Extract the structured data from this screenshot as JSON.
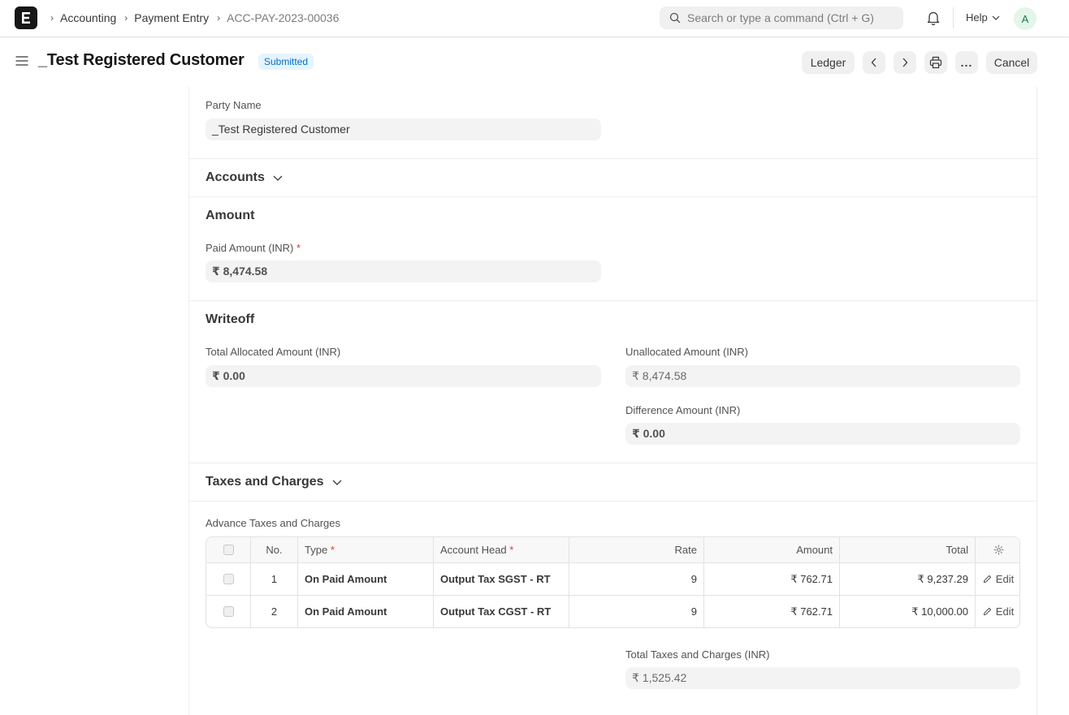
{
  "navbar": {
    "breadcrumbs": [
      "Accounting",
      "Payment Entry",
      "ACC-PAY-2023-00036"
    ],
    "search_placeholder": "Search or type a command (Ctrl + G)",
    "help_label": "Help",
    "avatar_initial": "A"
  },
  "page": {
    "title": "_Test Registered Customer",
    "status": "Submitted",
    "buttons": {
      "ledger": "Ledger",
      "cancel": "Cancel",
      "more": "..."
    }
  },
  "form": {
    "party_name": {
      "label": "Party Name",
      "value": "_Test Registered Customer"
    },
    "accounts_section": "Accounts",
    "amount_section": "Amount",
    "paid_amount": {
      "label": "Paid Amount (INR)",
      "value": "₹ 8,474.58"
    },
    "writeoff_section": "Writeoff",
    "total_allocated": {
      "label": "Total Allocated Amount (INR)",
      "value": "₹ 0.00"
    },
    "unallocated": {
      "label": "Unallocated Amount (INR)",
      "value": "₹ 8,474.58"
    },
    "difference": {
      "label": "Difference Amount (INR)",
      "value": "₹ 0.00"
    },
    "taxes_section": "Taxes and Charges",
    "advance_taxes_label": "Advance Taxes and Charges",
    "taxes_table": {
      "headers": {
        "no": "No.",
        "type": "Type",
        "account_head": "Account Head",
        "rate": "Rate",
        "amount": "Amount",
        "total": "Total"
      },
      "rows": [
        {
          "no": "1",
          "type": "On Paid Amount",
          "account_head": "Output Tax SGST - RT",
          "rate": "9",
          "amount": "₹ 762.71",
          "total": "₹ 9,237.29",
          "edit": "Edit"
        },
        {
          "no": "2",
          "type": "On Paid Amount",
          "account_head": "Output Tax CGST - RT",
          "rate": "9",
          "amount": "₹ 762.71",
          "total": "₹ 10,000.00",
          "edit": "Edit"
        }
      ]
    },
    "total_taxes": {
      "label": "Total Taxes and Charges (INR)",
      "value": "₹ 1,525.42"
    }
  },
  "colors": {
    "status_badge_bg": "#e6f4ff",
    "status_badge_text": "#0070cc",
    "required": "#e03636"
  }
}
